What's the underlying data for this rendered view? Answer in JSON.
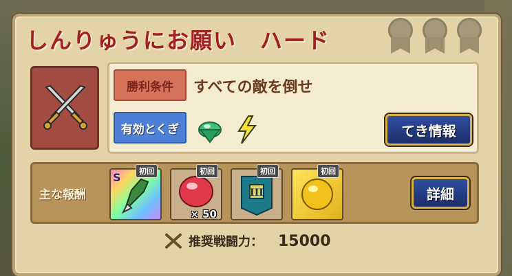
{
  "quest": {
    "title": "しんりゅうにお願い　ハード",
    "medals": [
      "medal-icon",
      "medal-icon",
      "medal-icon"
    ]
  },
  "conditions": {
    "win_label": "勝利条件",
    "win_text": "すべての敵を倒せ",
    "effective_label": "有効とくぎ",
    "effective_icons": [
      "green-gem-icon",
      "lightning-icon"
    ],
    "enemy_info_button": "てき情報"
  },
  "rewards": {
    "label": "主な報酬",
    "detail_button": "詳細",
    "items": [
      {
        "badge": "初回",
        "icon": "dragon-weapon-icon",
        "rank": "S",
        "qty": ""
      },
      {
        "badge": "初回",
        "icon": "red-gem-icon",
        "rank": "",
        "qty": "× 50"
      },
      {
        "badge": "初回",
        "icon": "banner-III-icon",
        "rank": "",
        "qty": ""
      },
      {
        "badge": "初回",
        "icon": "gold-orb-icon",
        "rank": "",
        "qty": ""
      }
    ]
  },
  "recommended": {
    "label": "推奨戦闘力：",
    "value": "15000"
  },
  "colors": {
    "title": "#a0201f",
    "button": "#1c2e6b",
    "button_border": "#d8b04a"
  }
}
